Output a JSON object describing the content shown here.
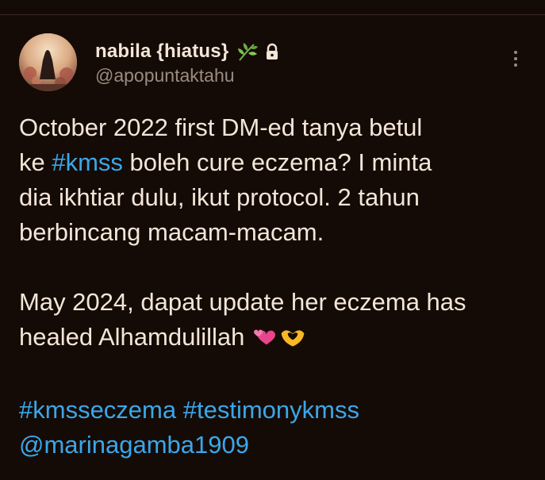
{
  "tweet": {
    "display_name": "nabila {hiatus}",
    "handle": "@apopuntaktahu",
    "text": {
      "p1_a": "October 2022 first DM-ed tanya betul",
      "p1_b_pre": "ke ",
      "p1_b_tag": "#kmss",
      "p1_b_post": " boleh cure eczema? I minta",
      "p1_c": "dia ikhtiar dulu, ikut protocol. 2 tahun",
      "p1_d": "berbincang macam-macam.",
      "p2_a": "May 2024, dapat update her eczema has",
      "p2_b": "healed Alhamdulillah",
      "tag1": "#kmsseczema",
      "tag2": "#testimonykmss",
      "mention": "@marinagamba1909"
    },
    "icons": [
      "herb-icon",
      "lock-icon",
      "more-options-icon",
      "two-hearts-emoji",
      "heart-hands-emoji"
    ],
    "colors": {
      "background": "#150b06",
      "text": "#f3e6d8",
      "muted": "#9a8b80",
      "link": "#3aa7ea"
    }
  }
}
